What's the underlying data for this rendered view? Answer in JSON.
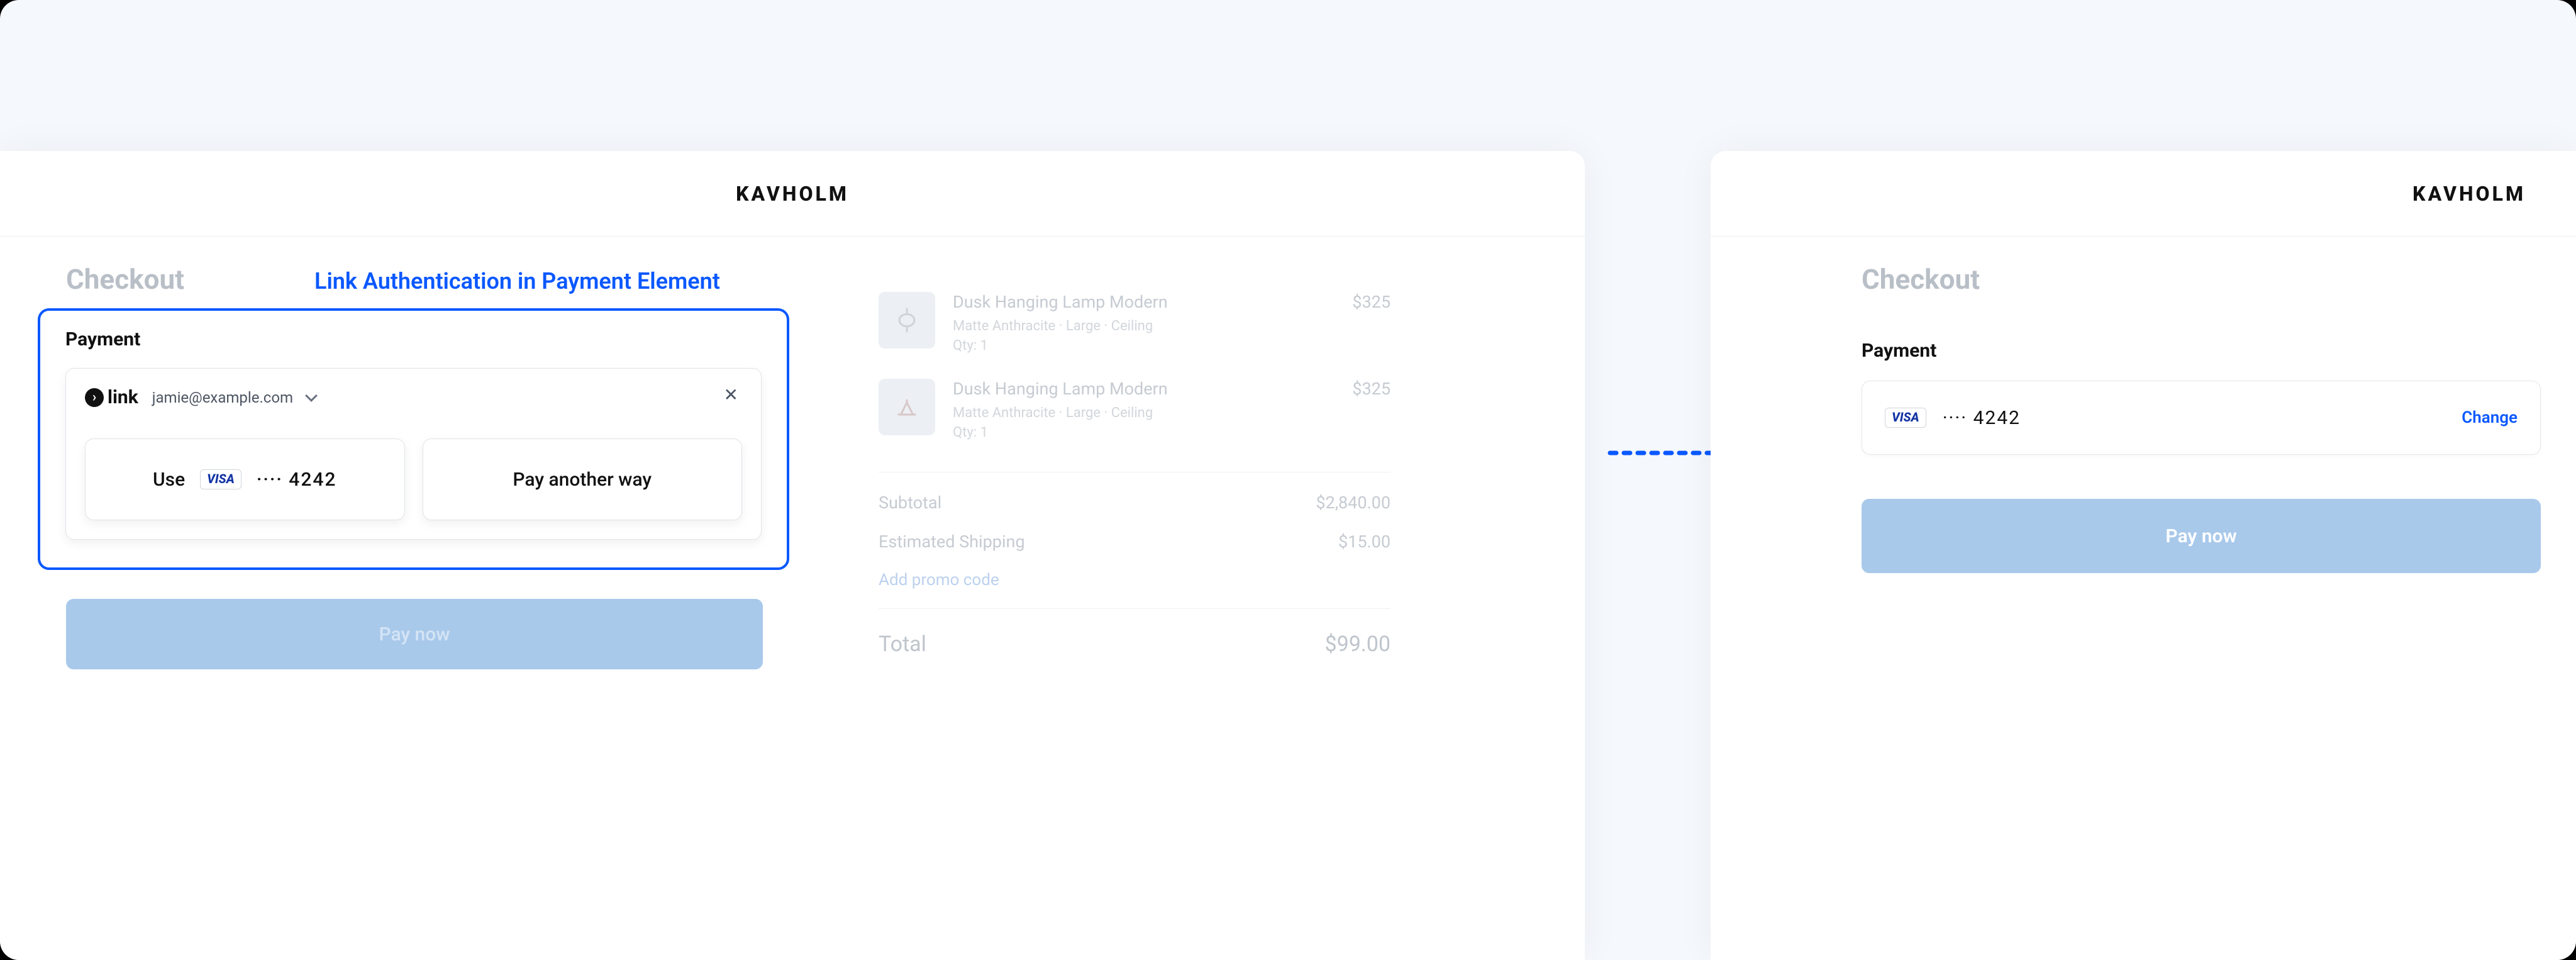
{
  "brand": "KAVHOLM",
  "callout": "Link Authentication in Payment Element",
  "left": {
    "checkout_title": "Checkout",
    "payment_label": "Payment",
    "link_logo_text": "link",
    "link_email": "jamie@example.com",
    "use_label": "Use",
    "card_last4_display": "···· 4242",
    "pay_another_label": "Pay another way",
    "pay_now_label": "Pay now"
  },
  "summary": {
    "items": [
      {
        "name": "Dusk Hanging Lamp Modern",
        "meta": "Matte Anthracite · Large · Ceiling",
        "qty": "Qty: 1",
        "price": "$325"
      },
      {
        "name": "Dusk Hanging Lamp Modern",
        "meta": "Matte Anthracite · Large · Ceiling",
        "qty": "Qty: 1",
        "price": "$325"
      }
    ],
    "subtotal_label": "Subtotal",
    "subtotal_value": "$2,840.00",
    "shipping_label": "Estimated Shipping",
    "shipping_value": "$15.00",
    "promo_label": "Add promo code",
    "total_label": "Total",
    "total_value": "$99.00"
  },
  "right": {
    "checkout_title": "Checkout",
    "payment_label": "Payment",
    "card_last4_display": "···· 4242",
    "change_label": "Change",
    "pay_now_label": "Pay now"
  }
}
